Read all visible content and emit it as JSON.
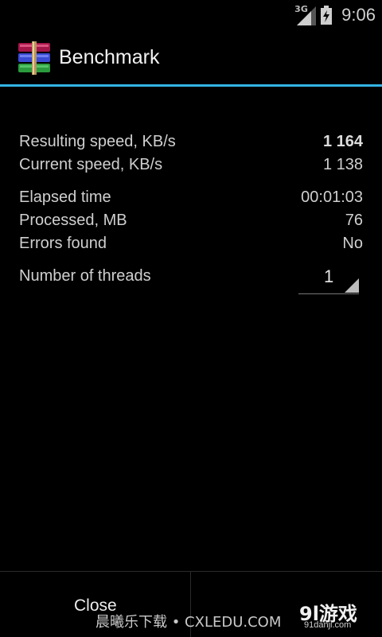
{
  "status_bar": {
    "network": "3G",
    "time": "9:06",
    "icons": [
      "signal-icon",
      "battery-icon"
    ]
  },
  "action_bar": {
    "title": "Benchmark",
    "accent_color": "#33b5e5",
    "icon": "winrar-books-icon"
  },
  "stats": [
    {
      "label": "Resulting speed, KB/s",
      "value": "1 164"
    },
    {
      "label": "Current speed, KB/s",
      "value": "1 138"
    },
    {
      "label": "Elapsed time",
      "value": "00:01:03"
    },
    {
      "label": "Processed, MB",
      "value": "76"
    },
    {
      "label": "Errors found",
      "value": "No"
    }
  ],
  "threads": {
    "label": "Number of threads",
    "value": "1"
  },
  "buttons": {
    "close": "Close"
  },
  "watermark": {
    "left": "晨曦乐下载 • CXLEDU.COM",
    "brand": "9l游戏",
    "brand_url": "91danji.com"
  }
}
